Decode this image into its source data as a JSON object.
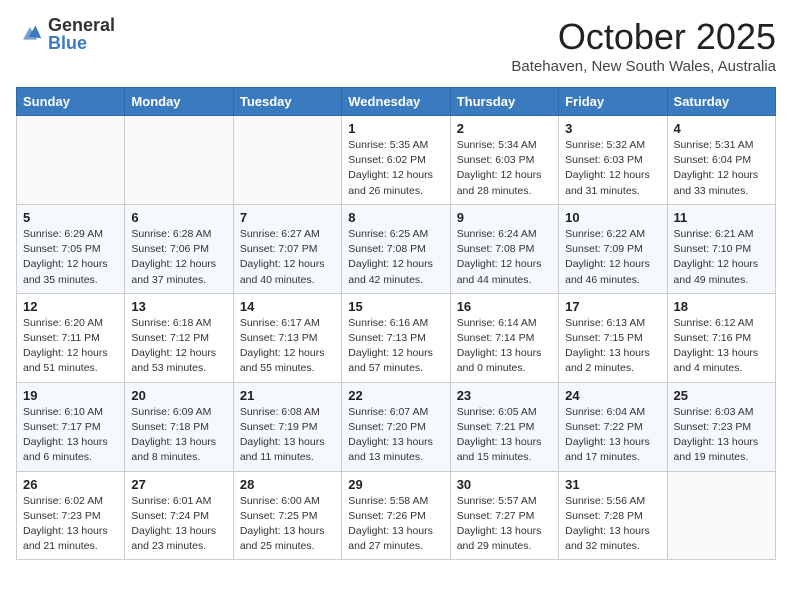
{
  "header": {
    "logo_general": "General",
    "logo_blue": "Blue",
    "month": "October 2025",
    "location": "Batehaven, New South Wales, Australia"
  },
  "weekdays": [
    "Sunday",
    "Monday",
    "Tuesday",
    "Wednesday",
    "Thursday",
    "Friday",
    "Saturday"
  ],
  "weeks": [
    [
      {
        "day": "",
        "info": ""
      },
      {
        "day": "",
        "info": ""
      },
      {
        "day": "",
        "info": ""
      },
      {
        "day": "1",
        "info": "Sunrise: 5:35 AM\nSunset: 6:02 PM\nDaylight: 12 hours\nand 26 minutes."
      },
      {
        "day": "2",
        "info": "Sunrise: 5:34 AM\nSunset: 6:03 PM\nDaylight: 12 hours\nand 28 minutes."
      },
      {
        "day": "3",
        "info": "Sunrise: 5:32 AM\nSunset: 6:03 PM\nDaylight: 12 hours\nand 31 minutes."
      },
      {
        "day": "4",
        "info": "Sunrise: 5:31 AM\nSunset: 6:04 PM\nDaylight: 12 hours\nand 33 minutes."
      }
    ],
    [
      {
        "day": "5",
        "info": "Sunrise: 6:29 AM\nSunset: 7:05 PM\nDaylight: 12 hours\nand 35 minutes."
      },
      {
        "day": "6",
        "info": "Sunrise: 6:28 AM\nSunset: 7:06 PM\nDaylight: 12 hours\nand 37 minutes."
      },
      {
        "day": "7",
        "info": "Sunrise: 6:27 AM\nSunset: 7:07 PM\nDaylight: 12 hours\nand 40 minutes."
      },
      {
        "day": "8",
        "info": "Sunrise: 6:25 AM\nSunset: 7:08 PM\nDaylight: 12 hours\nand 42 minutes."
      },
      {
        "day": "9",
        "info": "Sunrise: 6:24 AM\nSunset: 7:08 PM\nDaylight: 12 hours\nand 44 minutes."
      },
      {
        "day": "10",
        "info": "Sunrise: 6:22 AM\nSunset: 7:09 PM\nDaylight: 12 hours\nand 46 minutes."
      },
      {
        "day": "11",
        "info": "Sunrise: 6:21 AM\nSunset: 7:10 PM\nDaylight: 12 hours\nand 49 minutes."
      }
    ],
    [
      {
        "day": "12",
        "info": "Sunrise: 6:20 AM\nSunset: 7:11 PM\nDaylight: 12 hours\nand 51 minutes."
      },
      {
        "day": "13",
        "info": "Sunrise: 6:18 AM\nSunset: 7:12 PM\nDaylight: 12 hours\nand 53 minutes."
      },
      {
        "day": "14",
        "info": "Sunrise: 6:17 AM\nSunset: 7:13 PM\nDaylight: 12 hours\nand 55 minutes."
      },
      {
        "day": "15",
        "info": "Sunrise: 6:16 AM\nSunset: 7:13 PM\nDaylight: 12 hours\nand 57 minutes."
      },
      {
        "day": "16",
        "info": "Sunrise: 6:14 AM\nSunset: 7:14 PM\nDaylight: 13 hours\nand 0 minutes."
      },
      {
        "day": "17",
        "info": "Sunrise: 6:13 AM\nSunset: 7:15 PM\nDaylight: 13 hours\nand 2 minutes."
      },
      {
        "day": "18",
        "info": "Sunrise: 6:12 AM\nSunset: 7:16 PM\nDaylight: 13 hours\nand 4 minutes."
      }
    ],
    [
      {
        "day": "19",
        "info": "Sunrise: 6:10 AM\nSunset: 7:17 PM\nDaylight: 13 hours\nand 6 minutes."
      },
      {
        "day": "20",
        "info": "Sunrise: 6:09 AM\nSunset: 7:18 PM\nDaylight: 13 hours\nand 8 minutes."
      },
      {
        "day": "21",
        "info": "Sunrise: 6:08 AM\nSunset: 7:19 PM\nDaylight: 13 hours\nand 11 minutes."
      },
      {
        "day": "22",
        "info": "Sunrise: 6:07 AM\nSunset: 7:20 PM\nDaylight: 13 hours\nand 13 minutes."
      },
      {
        "day": "23",
        "info": "Sunrise: 6:05 AM\nSunset: 7:21 PM\nDaylight: 13 hours\nand 15 minutes."
      },
      {
        "day": "24",
        "info": "Sunrise: 6:04 AM\nSunset: 7:22 PM\nDaylight: 13 hours\nand 17 minutes."
      },
      {
        "day": "25",
        "info": "Sunrise: 6:03 AM\nSunset: 7:23 PM\nDaylight: 13 hours\nand 19 minutes."
      }
    ],
    [
      {
        "day": "26",
        "info": "Sunrise: 6:02 AM\nSunset: 7:23 PM\nDaylight: 13 hours\nand 21 minutes."
      },
      {
        "day": "27",
        "info": "Sunrise: 6:01 AM\nSunset: 7:24 PM\nDaylight: 13 hours\nand 23 minutes."
      },
      {
        "day": "28",
        "info": "Sunrise: 6:00 AM\nSunset: 7:25 PM\nDaylight: 13 hours\nand 25 minutes."
      },
      {
        "day": "29",
        "info": "Sunrise: 5:58 AM\nSunset: 7:26 PM\nDaylight: 13 hours\nand 27 minutes."
      },
      {
        "day": "30",
        "info": "Sunrise: 5:57 AM\nSunset: 7:27 PM\nDaylight: 13 hours\nand 29 minutes."
      },
      {
        "day": "31",
        "info": "Sunrise: 5:56 AM\nSunset: 7:28 PM\nDaylight: 13 hours\nand 32 minutes."
      },
      {
        "day": "",
        "info": ""
      }
    ]
  ]
}
